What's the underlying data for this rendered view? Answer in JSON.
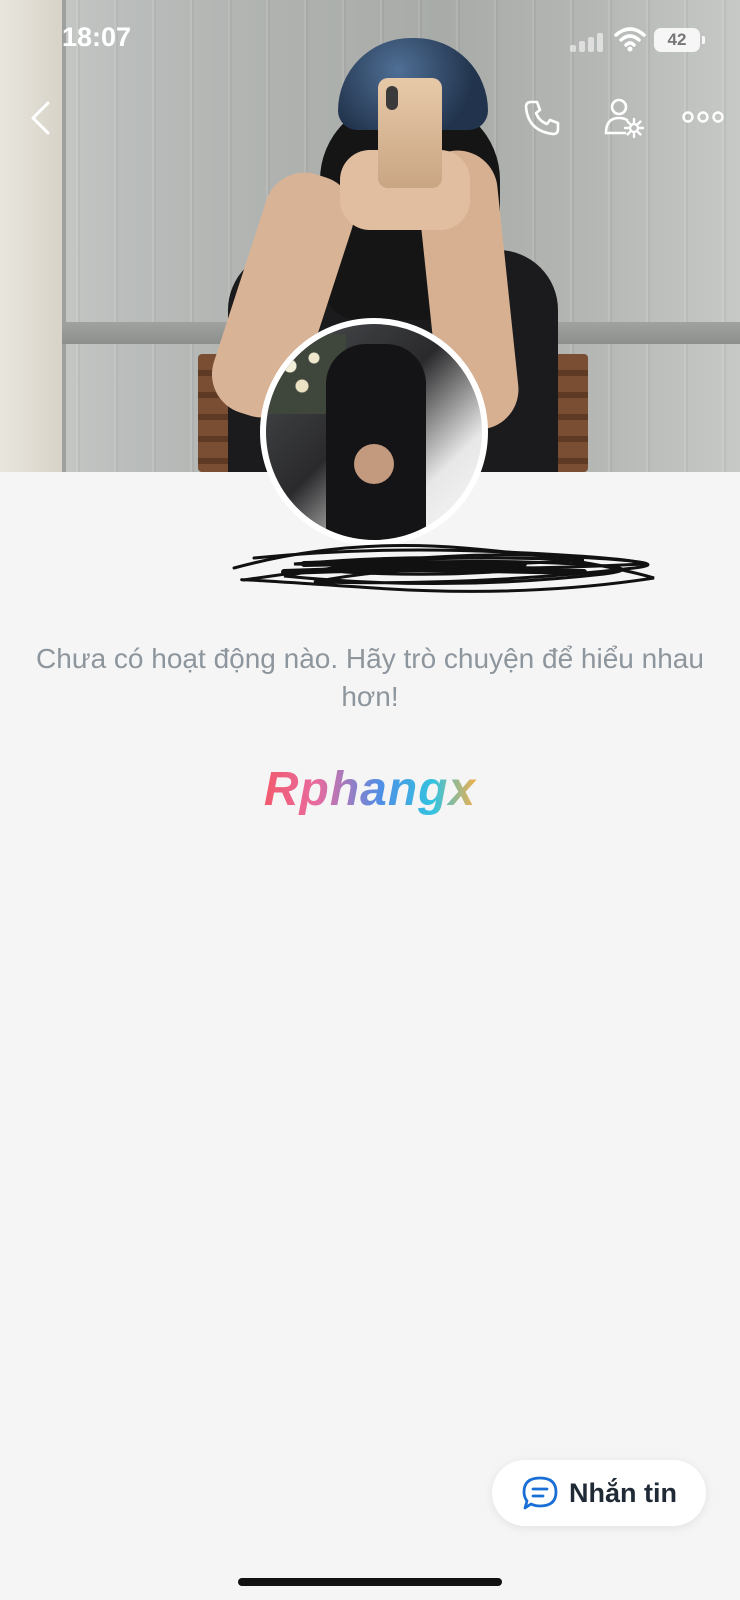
{
  "status_bar": {
    "time": "18:07",
    "battery": "42"
  },
  "header": {
    "back_icon": "chevron-left-icon",
    "call_icon": "phone-icon",
    "settings_icon": "user-settings-icon",
    "more_icon": "more-horizontal-icon"
  },
  "profile": {
    "name": ""
  },
  "feed": {
    "empty_message": "Chưa có hoạt động nào. Hãy trò chuyện để hiểu nhau hơn!"
  },
  "watermark": {
    "text": "Rphangx"
  },
  "actions": {
    "message_label": "Nhắn tin",
    "message_icon": "chat-bubble-icon"
  },
  "colors": {
    "text_muted": "#8e969d",
    "accent": "#1a6fd6",
    "background": "#f5f5f6"
  }
}
